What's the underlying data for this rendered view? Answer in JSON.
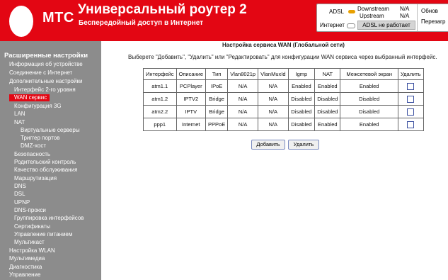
{
  "header": {
    "brand": "МТС",
    "title": "Универсальный роутер 2",
    "subtitle": "Беспередойный доступ в Интернет",
    "status": {
      "adsl_label": "ADSL",
      "downstream_label": "Downstream",
      "downstream_value": "N/A",
      "upstream_label": "Upstream",
      "upstream_value": "N/A",
      "internet_label": "Интернет",
      "adsl_state": "ADSL не работает",
      "right_top": "Обнов",
      "right_bottom": "Перезагр"
    }
  },
  "sidebar": {
    "heading": "Расширенные настройки",
    "items": [
      {
        "label": "Информация об устройстве"
      },
      {
        "label": "Соединение с Интернет"
      },
      {
        "label": "Дополнительные настройки"
      },
      {
        "label": "Интерфейс 2-го уровня"
      },
      {
        "label": "WAN сервис"
      },
      {
        "label": "Конфигурация 3G"
      },
      {
        "label": "LAN"
      },
      {
        "label": "NAT"
      },
      {
        "label": "Виртуальные серверы"
      },
      {
        "label": "Триггер портов"
      },
      {
        "label": "DMZ-хост"
      },
      {
        "label": "Безопасность"
      },
      {
        "label": "Родительский контроль"
      },
      {
        "label": "Качество обслуживания"
      },
      {
        "label": "Маршрутизация"
      },
      {
        "label": "DNS"
      },
      {
        "label": "DSL"
      },
      {
        "label": "UPNP"
      },
      {
        "label": "DNS-прокси"
      },
      {
        "label": "Группировка интерфейсов"
      },
      {
        "label": "Сертификаты"
      },
      {
        "label": "Управление питанием"
      },
      {
        "label": "Мультикаст"
      },
      {
        "label": "Настройка WLAN"
      },
      {
        "label": "Мультимедиа"
      },
      {
        "label": "Диагностика"
      },
      {
        "label": "Управление"
      }
    ]
  },
  "main": {
    "title": "Настройка сервиса WAN (Глобальной сети)",
    "instructions": "Выберете \"Добавить\", \"Удалить\" или \"Редактировать\" для конфигурации WAN сервиса через выбранный интерфейс.",
    "table": {
      "headers": [
        "Интерфейс",
        "Описание",
        "Тип",
        "Vlan8021p",
        "VlanMuxId",
        "Igmp",
        "NAT",
        "Межсетевой экран",
        "Удалить"
      ],
      "rows": [
        [
          "atm1.1",
          "PCPlayer",
          "IPoE",
          "N/A",
          "N/A",
          "Enabled",
          "Enabled",
          "Enabled"
        ],
        [
          "atm1.2",
          "IPTV2",
          "Bridge",
          "N/A",
          "N/A",
          "Disabled",
          "Disabled",
          "Disabled"
        ],
        [
          "atm2.2",
          "IPTV",
          "Bridge",
          "N/A",
          "N/A",
          "Disabled",
          "Disabled",
          "Disabled"
        ],
        [
          "ppp1",
          "Internet",
          "PPPoE",
          "N/A",
          "N/A",
          "Disabled",
          "Enabled",
          "Enabled"
        ]
      ]
    },
    "buttons": {
      "add": "Добавить",
      "remove": "Удалить"
    }
  },
  "colors": {
    "brand_red": "#e30613",
    "sidebar_gray": "#8c8c8c",
    "adsl_led": "#e8a000"
  }
}
